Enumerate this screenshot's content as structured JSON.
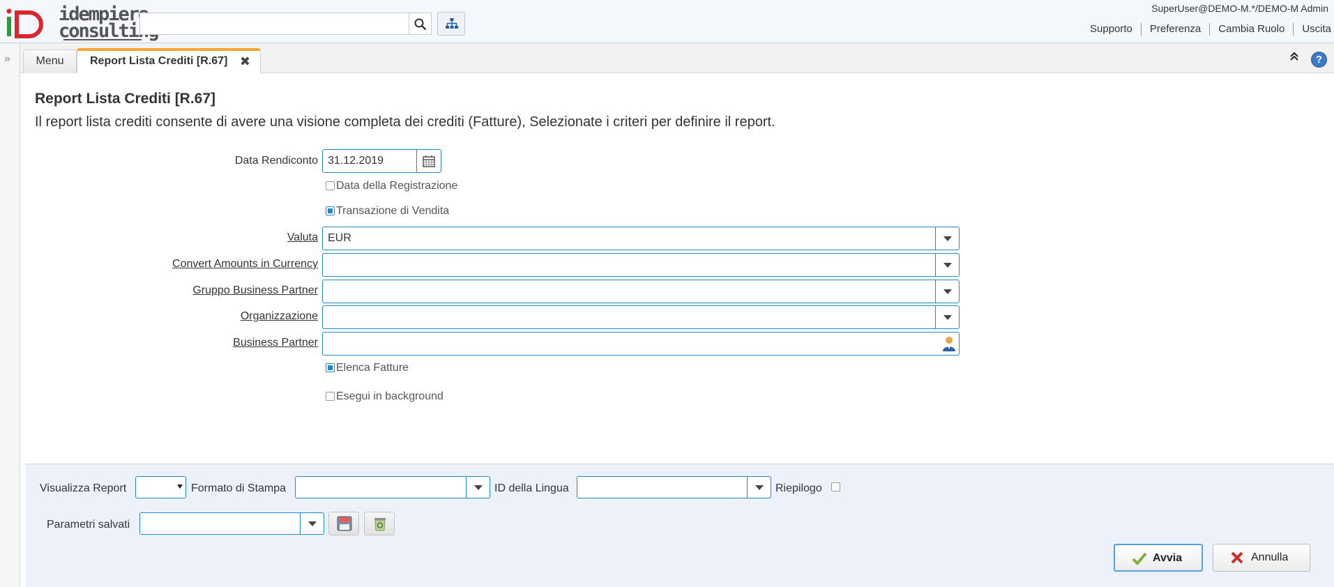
{
  "app": {
    "logo_line1": "idempiere",
    "logo_line2": "consulting",
    "search_placeholder": "",
    "user": "SuperUser@DEMO-M.*/DEMO-M Admin",
    "links": [
      "Supporto",
      "Preferenza",
      "Cambia Ruolo",
      "Uscita"
    ]
  },
  "tabs": {
    "menu_label": "Menu",
    "active_label": "Report Lista Crediti [R.67]",
    "close_glyph": "✖"
  },
  "colors": {
    "accent": "#f5a533",
    "field_border": "#1e88c8",
    "logo_red": "#d8272e",
    "logo_green": "#2e9a3e"
  },
  "form": {
    "title": "Report Lista Crediti [R.67]",
    "description": "Il report lista crediti consente di avere una visione completa dei crediti (Fatture), Selezionate i criteri per definire il report.",
    "data_rendiconto": {
      "label": "Data Rendiconto",
      "value": "31.12.2019"
    },
    "data_registrazione": {
      "label": "Data della Registrazione",
      "checked": false
    },
    "transazione_vendita": {
      "label": "Transazione di Vendita",
      "checked": true
    },
    "valuta": {
      "label": "Valuta",
      "value": "EUR"
    },
    "convert_amounts": {
      "label": "Convert Amounts in Currency",
      "value": ""
    },
    "gruppo_bp": {
      "label": "Gruppo Business Partner",
      "value": ""
    },
    "organizzazione": {
      "label": "Organizzazione",
      "value": ""
    },
    "business_partner": {
      "label": "Business Partner",
      "value": ""
    },
    "elenca_fatture": {
      "label": "Elenca Fatture",
      "checked": true
    },
    "esegui_background": {
      "label": "Esegui in background",
      "checked": false
    }
  },
  "params": {
    "visualizza_report": {
      "label": "Visualizza Report",
      "value": ""
    },
    "formato_stampa": {
      "label": "Formato di Stampa",
      "value": ""
    },
    "id_lingua": {
      "label": "ID della Lingua",
      "value": ""
    },
    "riepilogo": {
      "label": "Riepilogo",
      "checked": false
    },
    "parametri_salvati": {
      "label": "Parametri salvati",
      "value": ""
    },
    "ok_label": "Avvia",
    "cancel_label": "Annulla"
  }
}
